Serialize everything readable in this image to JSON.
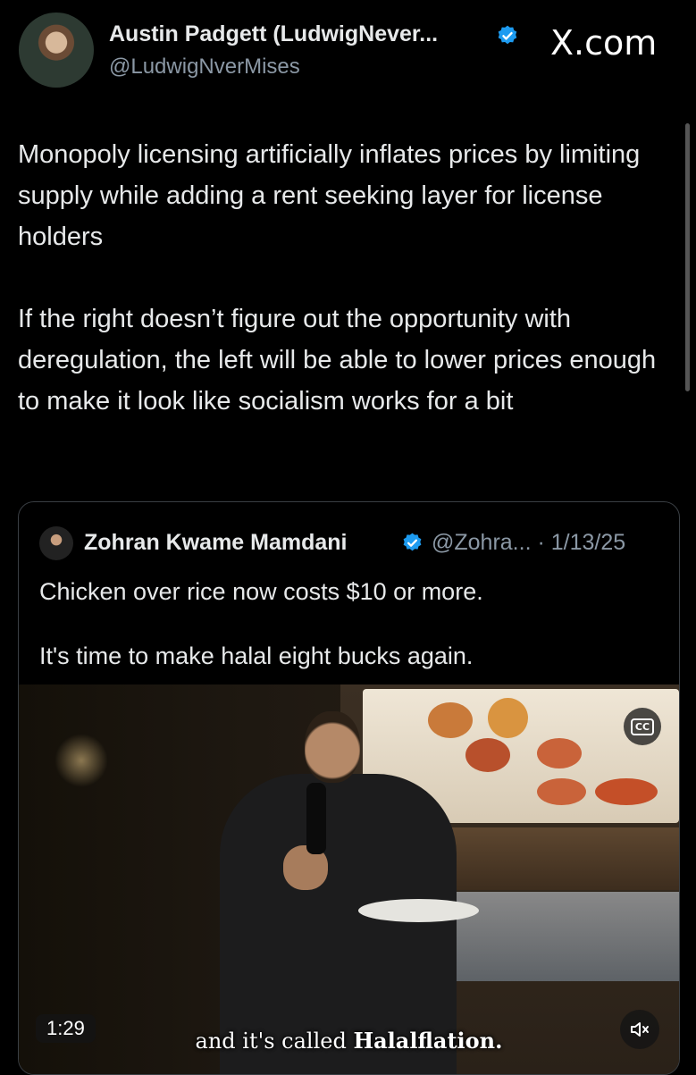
{
  "author": {
    "name": "Austin Padgett (LudwigNever...",
    "handle": "@LudwigNverMises",
    "verified_icon": "verified-badge-icon"
  },
  "site_logo": "X.com",
  "tweet": {
    "paragraphs": [
      "Monopoly licensing artificially inflates prices by limiting supply while adding a rent seeking layer for license holders",
      "If the right doesn’t figure out the opportunity with deregulation, the left will be able to lower prices enough to make it look like socialism works for a bit"
    ]
  },
  "quoted_tweet": {
    "name": "Zohran Kwame Mamdani",
    "handle_date": "@Zohra... · 1/13/25",
    "paragraphs": [
      "Chicken over rice now costs $10 or more.",
      "It's time to make halal eight bucks again."
    ],
    "video": {
      "cc_label": "CC",
      "duration": "1:29",
      "subtitle_prefix": "and it's called ",
      "subtitle_emphasis": "Halalflation.",
      "mute_icon": "speaker-muted-icon"
    }
  },
  "colors": {
    "background": "#000000",
    "text": "#e7e9ea",
    "muted": "#8b98a5",
    "verified": "#1d9bf0",
    "border": "#3a3f44"
  }
}
